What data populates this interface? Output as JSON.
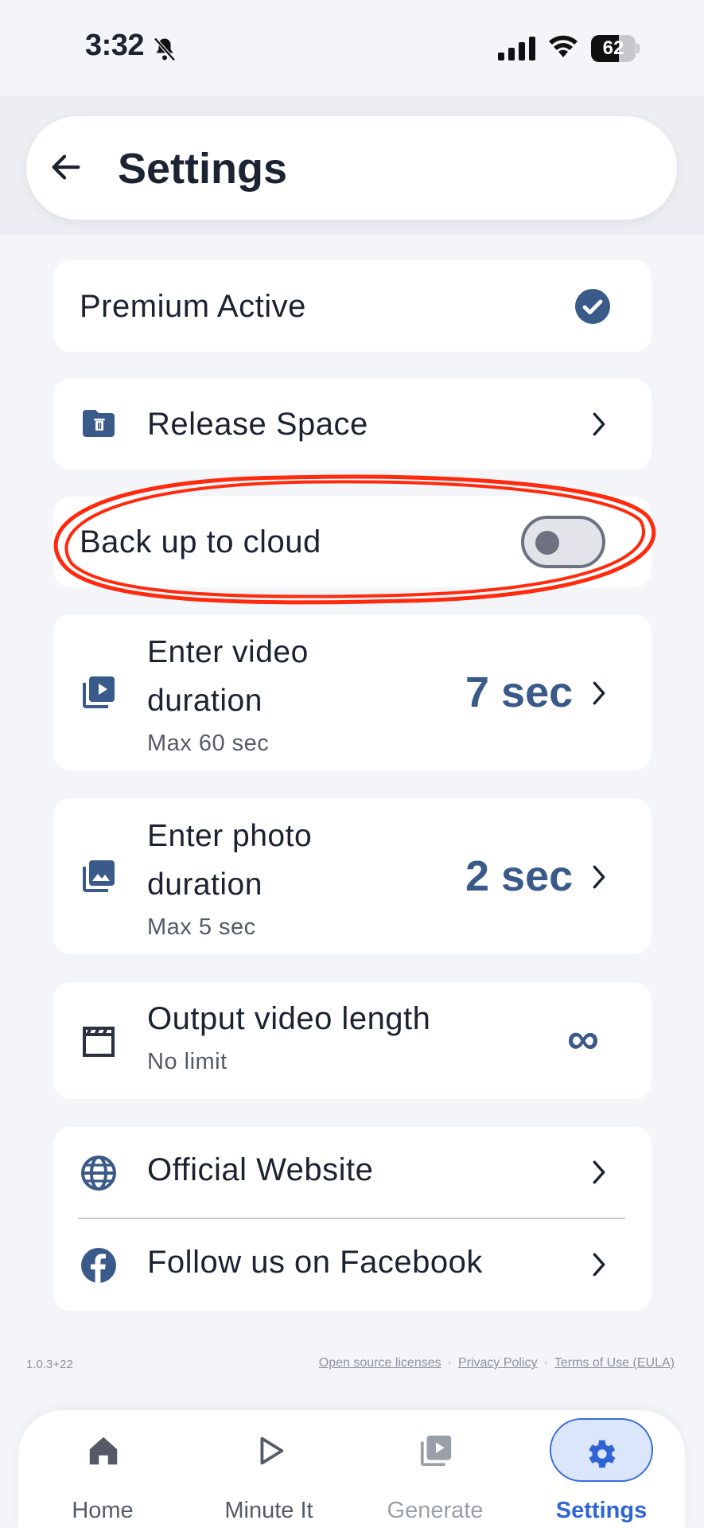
{
  "status_bar": {
    "time": "3:32",
    "battery": "62",
    "battery_level": 0.62
  },
  "header": {
    "title": "Settings"
  },
  "premium": {
    "label": "Premium Active"
  },
  "release_space": {
    "label": "Release Space"
  },
  "backup": {
    "label": "Back up to cloud",
    "enabled": false
  },
  "video_duration": {
    "title": "Enter video duration",
    "subtitle": "Max 60 sec",
    "value": "7 sec"
  },
  "photo_duration": {
    "title": "Enter photo duration",
    "subtitle": "Max 5 sec",
    "value": "2 sec"
  },
  "output_length": {
    "title": "Output video length",
    "subtitle": "No limit",
    "value": "∞"
  },
  "links": {
    "website": "Official Website",
    "facebook": "Follow us on Facebook"
  },
  "footer": {
    "version": "1.0.3+22",
    "open_source": "Open source licenses",
    "privacy": "Privacy Policy",
    "terms": "Terms of Use (EULA)",
    "separator": "·"
  },
  "tabs": [
    {
      "label": "Home",
      "icon": "home-icon"
    },
    {
      "label": "Minute It",
      "icon": "play-icon"
    },
    {
      "label": "Generate",
      "icon": "video-library-icon"
    },
    {
      "label": "Settings",
      "icon": "gear-icon"
    }
  ],
  "colors": {
    "accent": "#3a5a8a",
    "active_tab": "#2f64d6",
    "annotation": "#ff2a0e",
    "background": "#f3f5f9"
  }
}
